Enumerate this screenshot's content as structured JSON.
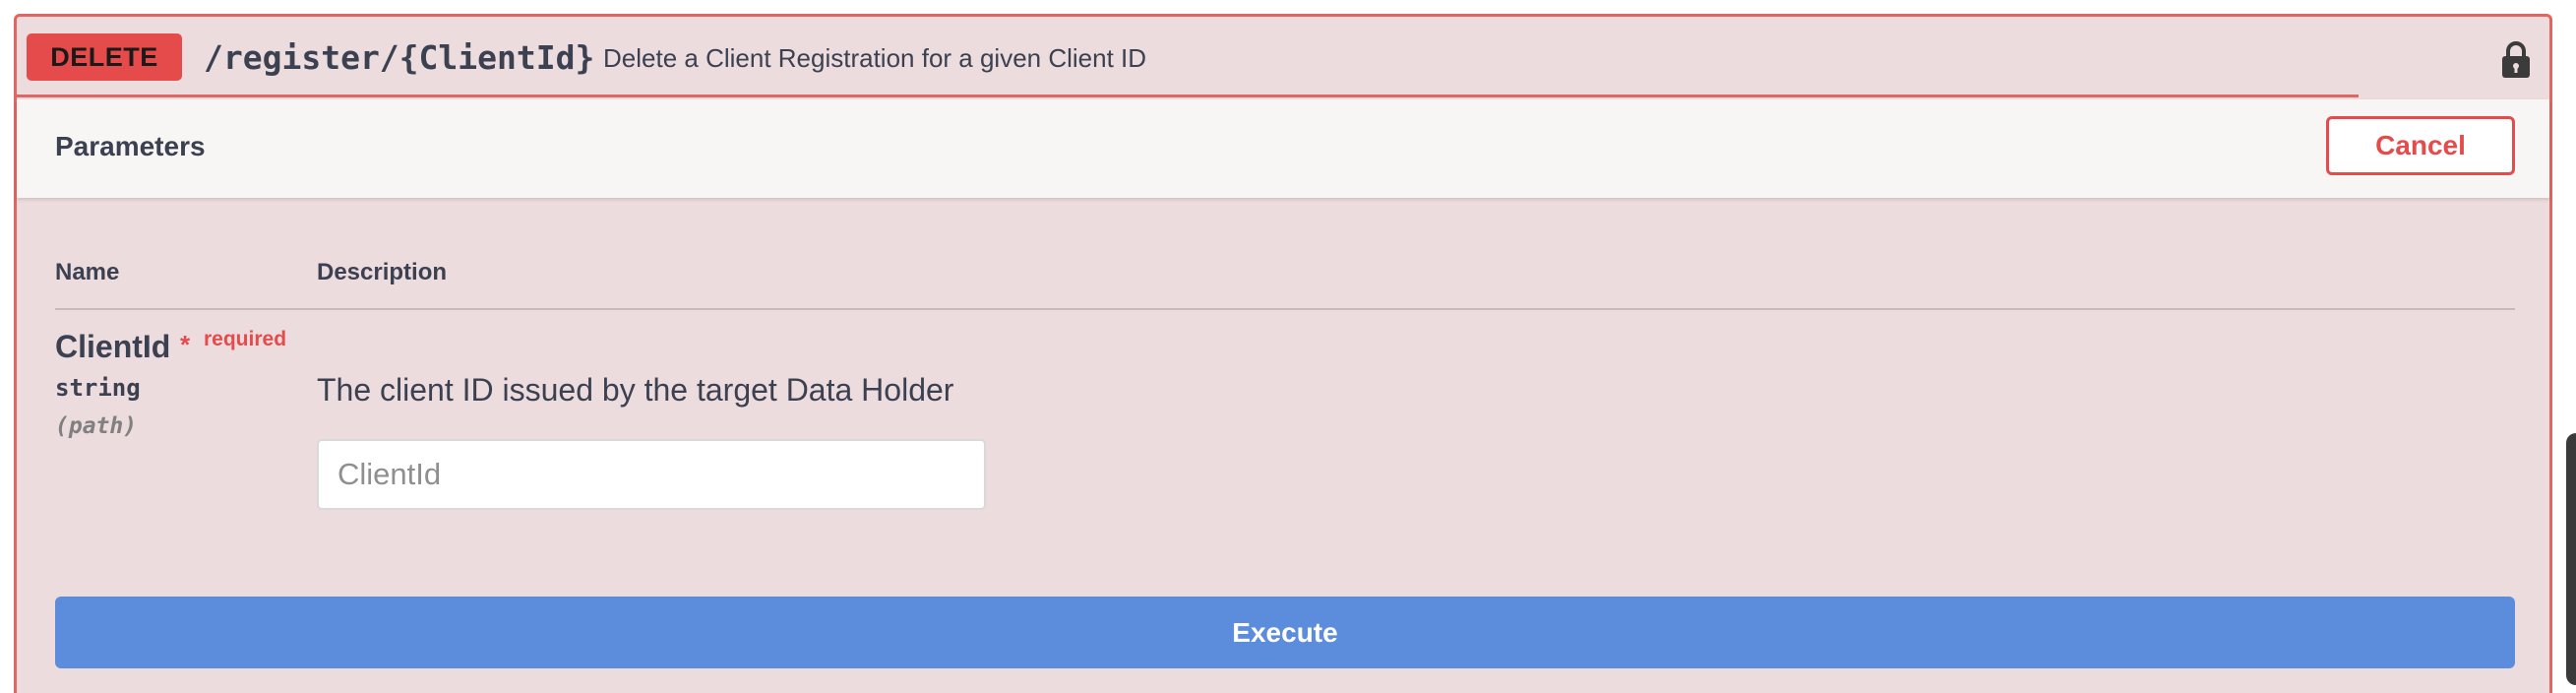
{
  "operation": {
    "method": "DELETE",
    "path": "/register/{ClientId}",
    "summary": "Delete a Client Registration for a given Client ID",
    "lock_icon": "lock-icon"
  },
  "parameters": {
    "title": "Parameters",
    "cancel_label": "Cancel",
    "columns": {
      "name": "Name",
      "description": "Description"
    },
    "items": [
      {
        "name": "ClientId",
        "required_marker": "*",
        "required_label": "required",
        "type": "string",
        "location": "(path)",
        "description": "The client ID issued by the target Data Holder",
        "input_value": "",
        "input_placeholder": "ClientId"
      }
    ]
  },
  "execute_label": "Execute",
  "colors": {
    "delete": "#e54b4b",
    "panel_background": "#ecdcdd",
    "execute": "#5b8ddc",
    "text": "#3b4151"
  }
}
